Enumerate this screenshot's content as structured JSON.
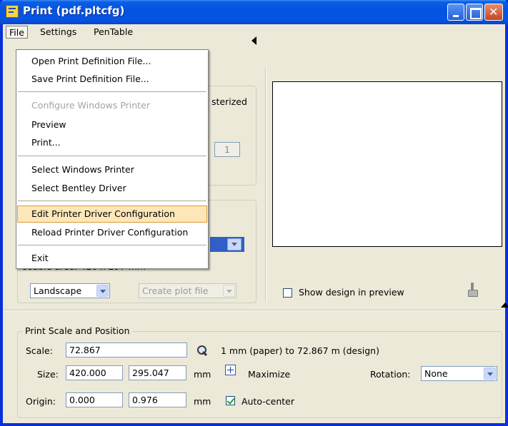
{
  "window": {
    "title": "Print  (pdf.pltcfg)"
  },
  "menubar": {
    "file": "File",
    "settings": "Settings",
    "pentable": "PenTable"
  },
  "file_menu": {
    "open": "Open Print Definition File...",
    "save": "Save Print Definition File...",
    "configure": "Configure Windows Printer",
    "preview": "Preview",
    "print": "Print...",
    "select_windows": "Select Windows Printer",
    "select_bentley": "Select Bentley Driver",
    "edit_driver": "Edit Printer Driver Configuration",
    "reload_driver": "Reload Printer Driver Configuration",
    "exit": "Exit"
  },
  "left_panel": {
    "rasterized_text": "sterized",
    "copies_value": "1",
    "usable_area_text": "Usable area:  420 x 297 mm",
    "orientation_value": "Landscape",
    "plot_file_value": "Create plot file"
  },
  "preview": {
    "show_design_label": "Show design in preview"
  },
  "scale_group": {
    "title": "Print Scale and Position",
    "scale_label": "Scale:",
    "scale_value": "72.867",
    "scale_text": "1 mm (paper) to 72.867 m  (design)",
    "size_label": "Size:",
    "size_x": "420.000",
    "size_y": "295.047",
    "size_units": "mm",
    "maximize_label": "Maximize",
    "rotation_label": "Rotation:",
    "rotation_value": "None",
    "origin_label": "Origin:",
    "origin_x": "0.000",
    "origin_y": "0.976",
    "origin_units": "mm",
    "autocenter_label": "Auto-center",
    "autocenter_checked": true,
    "show_design_checked": false
  },
  "colors": {
    "titlebar": "#0654e3",
    "dialog_bg": "#ece9d8",
    "highlight": "#fde7b8",
    "menu_border": "#808080"
  }
}
